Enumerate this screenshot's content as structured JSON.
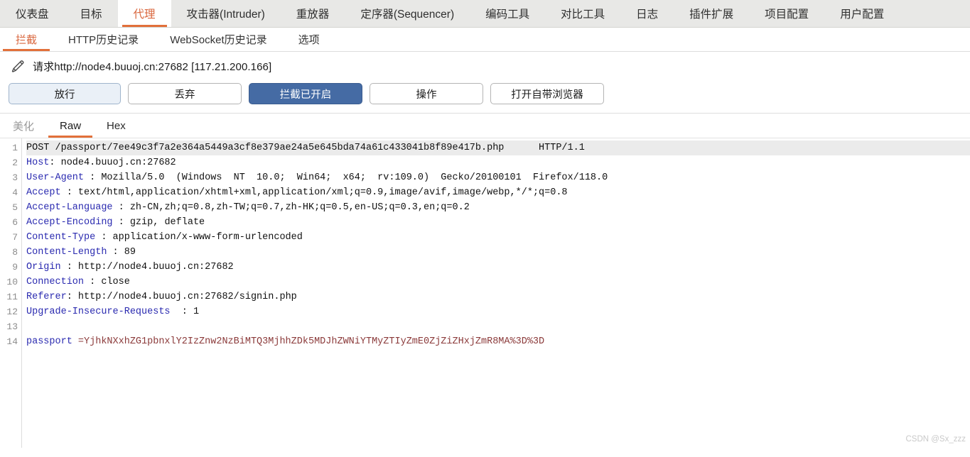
{
  "main_tabs": [
    {
      "label": "仪表盘",
      "active": false
    },
    {
      "label": "目标",
      "active": false
    },
    {
      "label": "代理",
      "active": true
    },
    {
      "label": "攻击器(Intruder)",
      "active": false
    },
    {
      "label": "重放器",
      "active": false
    },
    {
      "label": "定序器(Sequencer)",
      "active": false
    },
    {
      "label": "编码工具",
      "active": false
    },
    {
      "label": "对比工具",
      "active": false
    },
    {
      "label": "日志",
      "active": false
    },
    {
      "label": "插件扩展",
      "active": false
    },
    {
      "label": "项目配置",
      "active": false
    },
    {
      "label": "用户配置",
      "active": false
    }
  ],
  "sub_tabs": [
    {
      "label": "拦截",
      "active": true
    },
    {
      "label": "HTTP历史记录",
      "active": false
    },
    {
      "label": "WebSocket历史记录",
      "active": false
    },
    {
      "label": "选项",
      "active": false
    }
  ],
  "request_bar": {
    "icon": "pencil-icon",
    "title": "请求http://node4.buuoj.cn:27682  [117.21.200.166]"
  },
  "buttons": [
    {
      "label": "放行",
      "style": "forward"
    },
    {
      "label": "丢弃",
      "style": "drop"
    },
    {
      "label": "拦截已开启",
      "style": "intercept"
    },
    {
      "label": "操作",
      "style": "action"
    },
    {
      "label": "打开自带浏览器",
      "style": "browser"
    }
  ],
  "editor_tabs": [
    {
      "label": "美化",
      "active": false,
      "muted": true
    },
    {
      "label": "Raw",
      "active": true,
      "muted": false
    },
    {
      "label": "Hex",
      "active": false,
      "muted": false
    }
  ],
  "request_lines": [
    {
      "n": 1,
      "highlight": true,
      "parts": [
        {
          "t": "POST /passport/7ee49c3f7a2e364a5449a3cf8e379ae24a5e645bda74a61c433041b8f89e417b.php      HTTP/1.1",
          "c": "val"
        }
      ]
    },
    {
      "n": 2,
      "highlight": false,
      "parts": [
        {
          "t": "Host",
          "c": "hdr"
        },
        {
          "t": ": node4.buuoj.cn:27682",
          "c": "val"
        }
      ]
    },
    {
      "n": 3,
      "highlight": false,
      "parts": [
        {
          "t": "User-Agent",
          "c": "hdr"
        },
        {
          "t": " : Mozilla/5.0  (Windows  NT  10.0;  Win64;  x64;  rv:109.0)  Gecko/20100101  Firefox/118.0",
          "c": "val"
        }
      ]
    },
    {
      "n": 4,
      "highlight": false,
      "parts": [
        {
          "t": "Accept",
          "c": "hdr"
        },
        {
          "t": " : text/html,application/xhtml+xml,application/xml;q=0.9,image/avif,image/webp,*/*;q=0.8",
          "c": "val"
        }
      ]
    },
    {
      "n": 5,
      "highlight": false,
      "parts": [
        {
          "t": "Accept-Language",
          "c": "hdr"
        },
        {
          "t": " : zh-CN,zh;q=0.8,zh-TW;q=0.7,zh-HK;q=0.5,en-US;q=0.3,en;q=0.2",
          "c": "val"
        }
      ]
    },
    {
      "n": 6,
      "highlight": false,
      "parts": [
        {
          "t": "Accept-Encoding",
          "c": "hdr"
        },
        {
          "t": " : gzip, deflate",
          "c": "val"
        }
      ]
    },
    {
      "n": 7,
      "highlight": false,
      "parts": [
        {
          "t": "Content-Type",
          "c": "hdr"
        },
        {
          "t": " : application/x-www-form-urlencoded",
          "c": "val"
        }
      ]
    },
    {
      "n": 8,
      "highlight": false,
      "parts": [
        {
          "t": "Content-Length",
          "c": "hdr"
        },
        {
          "t": " : 89",
          "c": "val"
        }
      ]
    },
    {
      "n": 9,
      "highlight": false,
      "parts": [
        {
          "t": "Origin",
          "c": "hdr"
        },
        {
          "t": " : http://node4.buuoj.cn:27682",
          "c": "val"
        }
      ]
    },
    {
      "n": 10,
      "highlight": false,
      "parts": [
        {
          "t": "Connection",
          "c": "hdr"
        },
        {
          "t": " : close",
          "c": "val"
        }
      ]
    },
    {
      "n": 11,
      "highlight": false,
      "parts": [
        {
          "t": "Referer",
          "c": "hdr"
        },
        {
          "t": ": http://node4.buuoj.cn:27682/signin.php",
          "c": "val"
        }
      ]
    },
    {
      "n": 12,
      "highlight": false,
      "parts": [
        {
          "t": "Upgrade-Insecure-Requests",
          "c": "hdr"
        },
        {
          "t": "  : 1",
          "c": "val"
        }
      ]
    },
    {
      "n": 13,
      "highlight": false,
      "parts": []
    },
    {
      "n": 14,
      "highlight": false,
      "parts": [
        {
          "t": "passport",
          "c": "body-key"
        },
        {
          "t": " =YjhkNXxhZG1pbnxlY2IzZnw2NzBiMTQ3MjhhZDk5MDJhZWNiYTMyZTIyZmE0ZjZiZHxjZmR8MA%3D%3D",
          "c": "body-tok"
        }
      ]
    }
  ],
  "watermark": "CSDN @Sx_zzz"
}
